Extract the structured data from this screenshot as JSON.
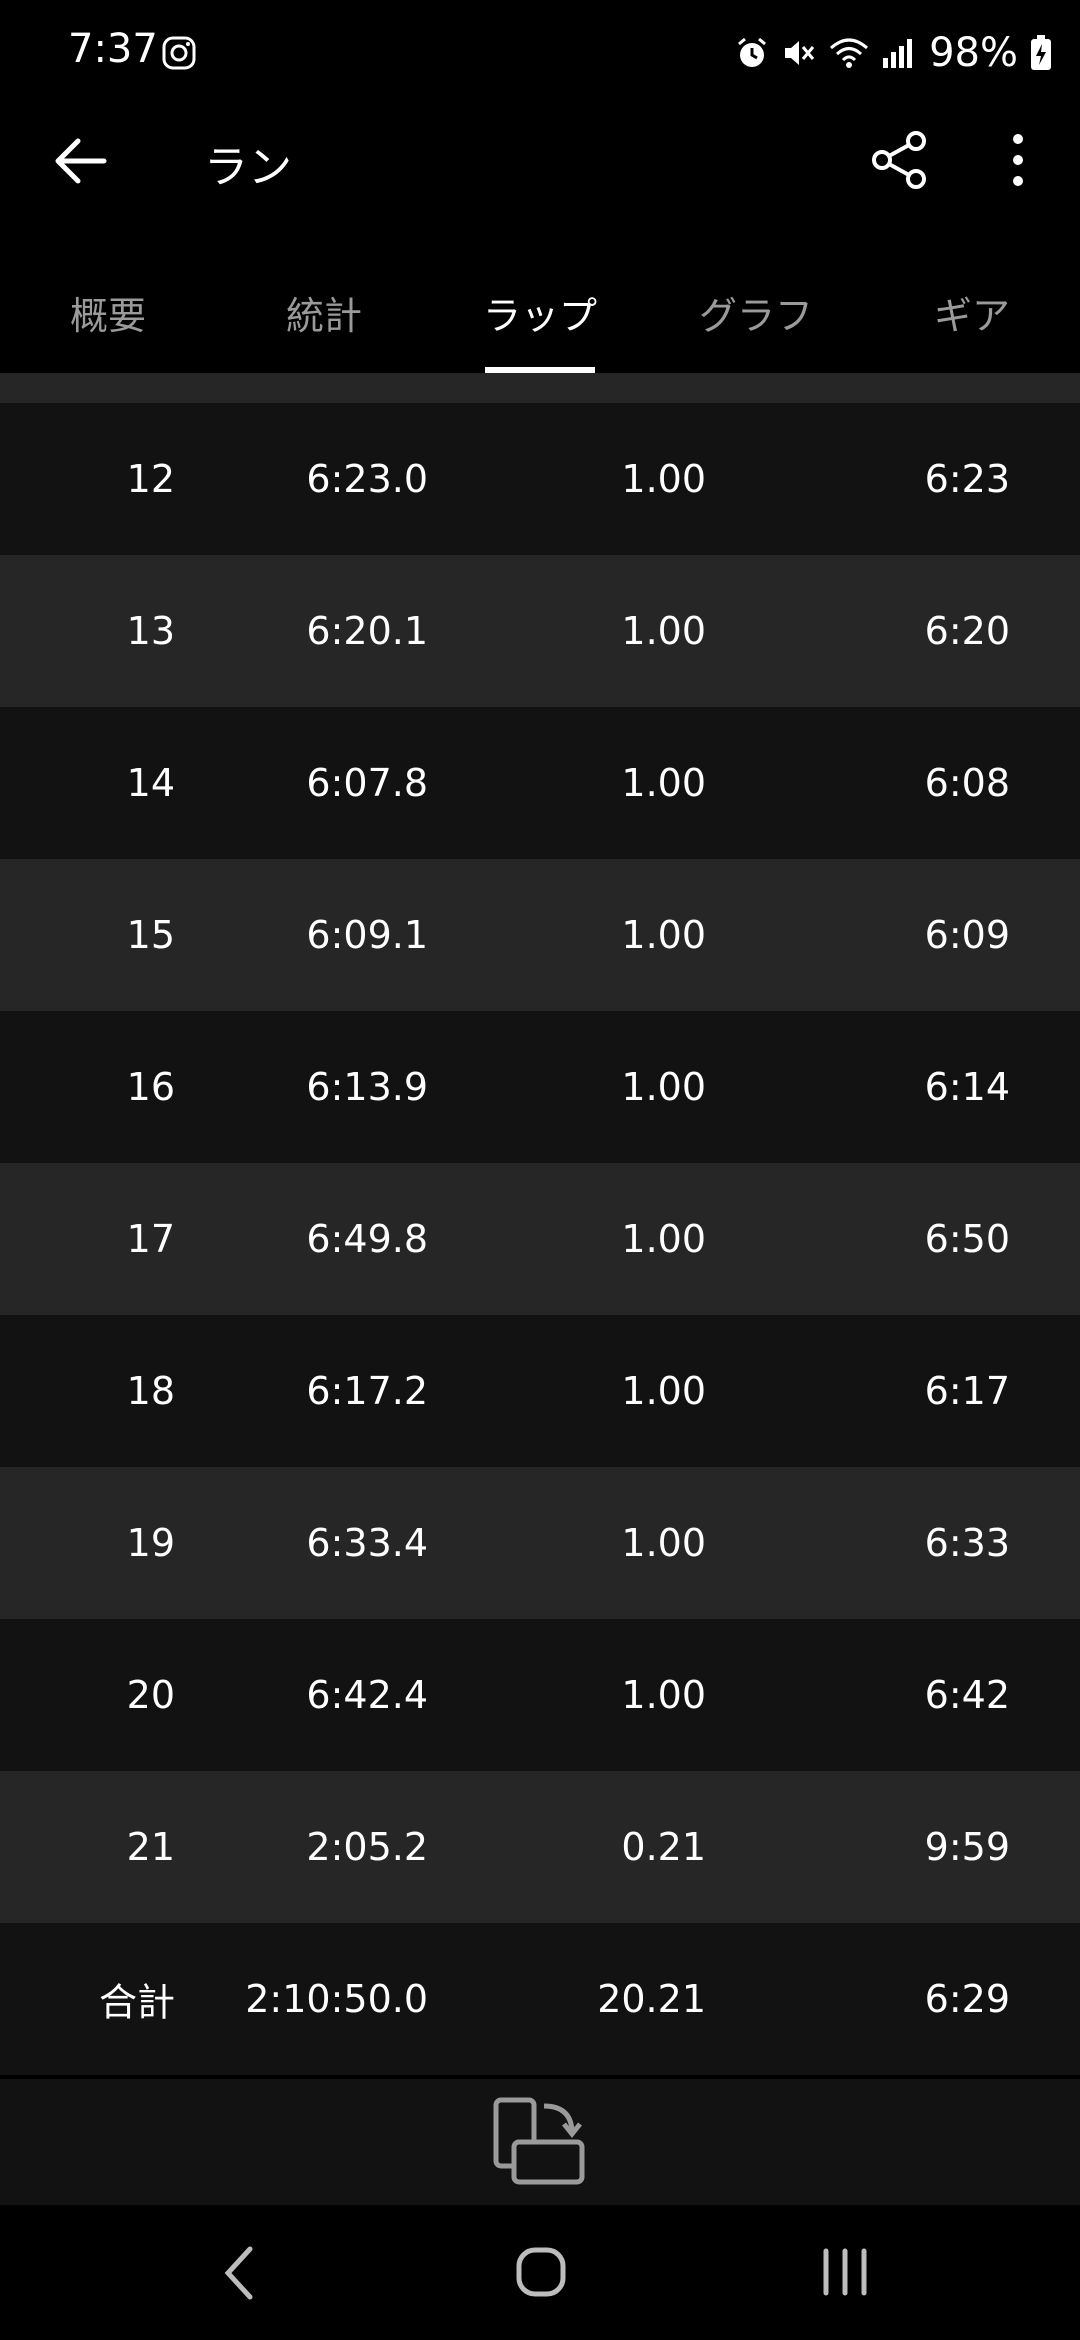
{
  "status_bar": {
    "time": "7:37",
    "battery": "98%",
    "icons": [
      "instagram-icon",
      "alarm-icon",
      "mute-icon",
      "wifi-icon",
      "signal-icon",
      "battery-charging-icon"
    ]
  },
  "app_bar": {
    "title": "ラン",
    "icons": [
      "back-arrow-icon",
      "share-icon",
      "more-vert-icon"
    ]
  },
  "tabs": [
    {
      "label": "概要",
      "active": false
    },
    {
      "label": "統計",
      "active": false
    },
    {
      "label": "ラップ",
      "active": true
    },
    {
      "label": "グラフ",
      "active": false
    },
    {
      "label": "ギア",
      "active": false
    }
  ],
  "laps": [
    {
      "lap": "12",
      "time": "6:23.0",
      "distance": "1.00",
      "pace": "6:23"
    },
    {
      "lap": "13",
      "time": "6:20.1",
      "distance": "1.00",
      "pace": "6:20"
    },
    {
      "lap": "14",
      "time": "6:07.8",
      "distance": "1.00",
      "pace": "6:08"
    },
    {
      "lap": "15",
      "time": "6:09.1",
      "distance": "1.00",
      "pace": "6:09"
    },
    {
      "lap": "16",
      "time": "6:13.9",
      "distance": "1.00",
      "pace": "6:14"
    },
    {
      "lap": "17",
      "time": "6:49.8",
      "distance": "1.00",
      "pace": "6:50"
    },
    {
      "lap": "18",
      "time": "6:17.2",
      "distance": "1.00",
      "pace": "6:17"
    },
    {
      "lap": "19",
      "time": "6:33.4",
      "distance": "1.00",
      "pace": "6:33"
    },
    {
      "lap": "20",
      "time": "6:42.4",
      "distance": "1.00",
      "pace": "6:42"
    },
    {
      "lap": "21",
      "time": "2:05.2",
      "distance": "0.21",
      "pace": "9:59"
    }
  ],
  "total": {
    "label": "合計",
    "time": "2:10:50.0",
    "distance": "20.21",
    "pace": "6:29"
  },
  "bottom": {
    "icon": "rotate-screen-icon"
  },
  "nav_bar": {
    "icons": [
      "nav-back-icon",
      "nav-home-icon",
      "nav-recents-icon"
    ]
  },
  "colors": {
    "background": "#000000",
    "row_dark": "#121212",
    "row_light": "#262626",
    "tab_inactive": "#9a9a9a",
    "text": "#ffffff"
  }
}
